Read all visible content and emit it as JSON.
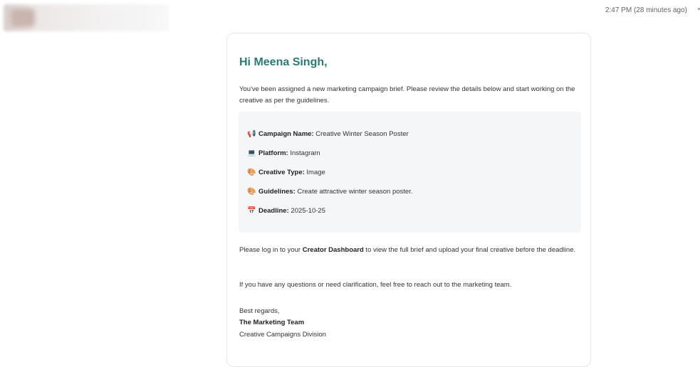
{
  "header": {
    "timestamp": "2:47 PM (28 minutes ago)"
  },
  "email": {
    "greeting": "Hi Meena Singh,",
    "intro": "You've been assigned a new marketing campaign brief. Please review the details below and start working on the creative as per the guidelines.",
    "details": [
      {
        "icon": "📢",
        "icon_name": "megaphone-icon",
        "label": "Campaign Name:",
        "value": "Creative Winter Season Poster"
      },
      {
        "icon": "💻",
        "icon_name": "laptop-icon",
        "label": "Platform:",
        "value": "Instagram"
      },
      {
        "icon": "🎨",
        "icon_name": "palette-icon",
        "label": "Creative Type:",
        "value": "Image"
      },
      {
        "icon": "🎨",
        "icon_name": "palette-icon",
        "label": "Guidelines:",
        "value": "Create attractive winter season poster."
      },
      {
        "icon": "📅",
        "icon_name": "calendar-icon",
        "label": "Deadline:",
        "value": "2025-10-25"
      }
    ],
    "login_pre": "Please log in to your ",
    "login_bold": "Creator Dashboard",
    "login_post": " to view the full brief and upload your final creative before the deadline.",
    "questions": "If you have any questions or need clarification, feel free to reach out to the marketing team.",
    "signoff": "Best regards,",
    "team": "The Marketing Team",
    "division": "Creative Campaigns Division"
  },
  "colors": {
    "greeting": "#2a7a76",
    "details_bg": "#f5f6f8"
  }
}
